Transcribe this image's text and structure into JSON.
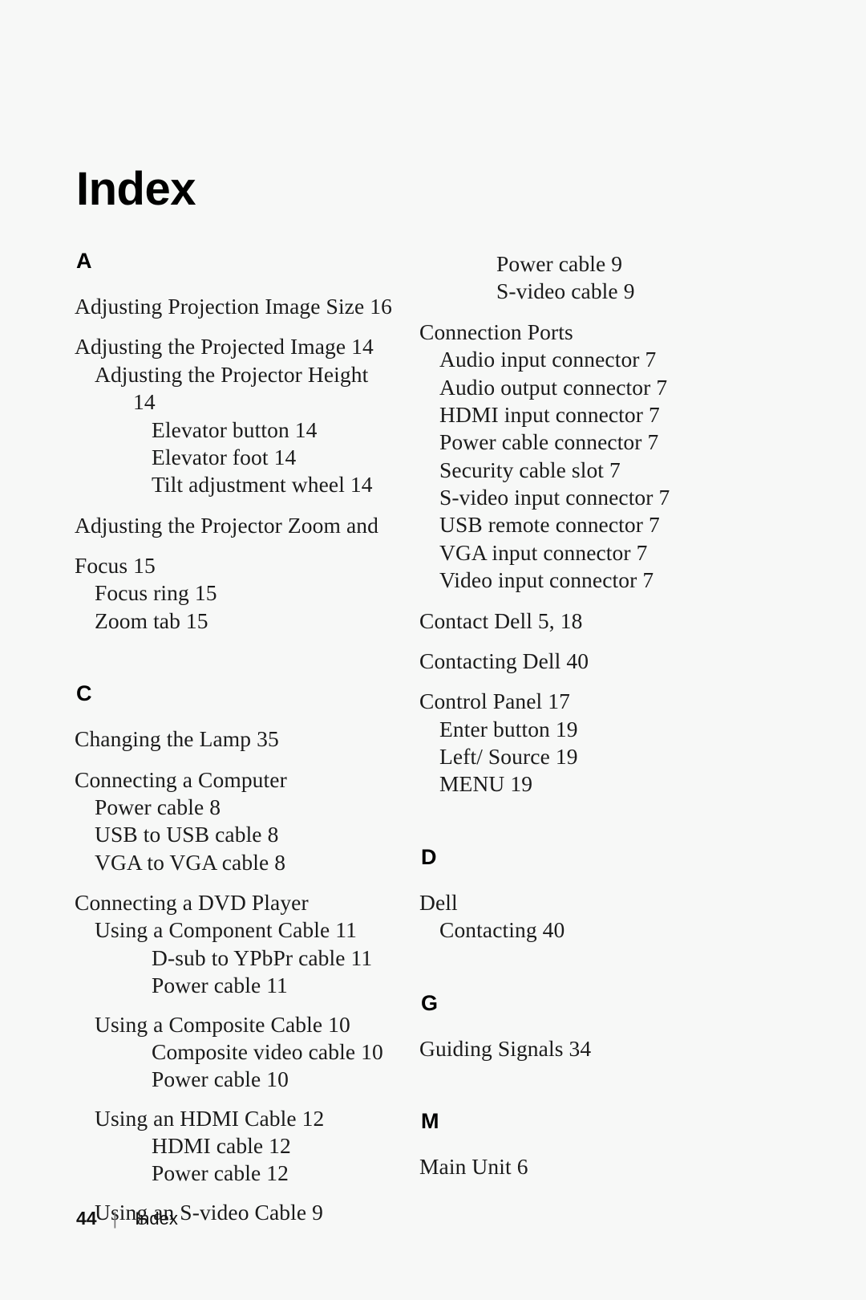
{
  "document": {
    "title": "Index"
  },
  "footer": {
    "page_number": "44",
    "separator": "|",
    "label": "Index"
  },
  "columns": {
    "left": {
      "sections": [
        {
          "letter": "A",
          "entries": [
            {
              "text": "Adjusting Projection Image Size 16",
              "level": 0
            },
            {
              "text": "Adjusting the Projected Image 14",
              "level": 0
            },
            {
              "text": "Adjusting the Projector Height",
              "level": 1
            },
            {
              "text": "14",
              "level": "cont"
            },
            {
              "text": "Elevator button 14",
              "level": 2
            },
            {
              "text": "Elevator foot 14",
              "level": 2
            },
            {
              "text": "Tilt adjustment wheel 14",
              "level": 2
            },
            {
              "text": "Adjusting the Projector Zoom and",
              "level": 0
            },
            {
              "text": "Focus 15",
              "level": 0
            },
            {
              "text": "Focus ring 15",
              "level": 1
            },
            {
              "text": "Zoom tab 15",
              "level": 1
            }
          ]
        },
        {
          "letter": "C",
          "entries": [
            {
              "text": "Changing the Lamp 35",
              "level": 0
            },
            {
              "text": "Connecting a Computer",
              "level": 0
            },
            {
              "text": "Power cable 8",
              "level": 1
            },
            {
              "text": "USB to USB cable 8",
              "level": 1
            },
            {
              "text": "VGA to VGA cable 8",
              "level": 1
            },
            {
              "text": "Connecting a DVD Player",
              "level": 0
            },
            {
              "text": "Using a Component Cable 11",
              "level": 1
            },
            {
              "text": "D-sub to YPbPr cable 11",
              "level": 2
            },
            {
              "text": "Power cable 11",
              "level": 2
            },
            {
              "text": "Using a Composite Cable 10",
              "level": 1
            },
            {
              "text": "Composite video cable 10",
              "level": 2
            },
            {
              "text": "Power cable 10",
              "level": 2
            },
            {
              "text": "Using an HDMI Cable 12",
              "level": 1
            },
            {
              "text": "HDMI cable 12",
              "level": 2
            },
            {
              "text": "Power cable 12",
              "level": 2
            },
            {
              "text": "Using an S-video Cable 9",
              "level": 1
            }
          ]
        }
      ]
    },
    "right": {
      "continued_entries": [
        {
          "text": "Power cable 9",
          "level": 2
        },
        {
          "text": "S-video cable 9",
          "level": 2
        }
      ],
      "sections": [
        {
          "letter": "",
          "entries": [
            {
              "text": "Connection Ports",
              "level": 0
            },
            {
              "text": "Audio input connector 7",
              "level": 1
            },
            {
              "text": "Audio output connector 7",
              "level": 1
            },
            {
              "text": "HDMI input connector 7",
              "level": 1
            },
            {
              "text": "Power cable connector 7",
              "level": 1
            },
            {
              "text": "Security cable slot 7",
              "level": 1
            },
            {
              "text": "S-video input connector 7",
              "level": 1
            },
            {
              "text": "USB remote connector 7",
              "level": 1
            },
            {
              "text": "VGA input connector 7",
              "level": 1
            },
            {
              "text": "Video input connector 7",
              "level": 1
            },
            {
              "text": "Contact Dell 5, 18",
              "level": 0
            },
            {
              "text": "Contacting Dell 40",
              "level": 0
            },
            {
              "text": "Control Panel 17",
              "level": 0
            },
            {
              "text": "Enter button 19",
              "level": 1
            },
            {
              "text": "Left/ Source 19",
              "level": 1
            },
            {
              "text": "MENU 19",
              "level": 1
            }
          ]
        },
        {
          "letter": "D",
          "entries": [
            {
              "text": "Dell",
              "level": 0
            },
            {
              "text": "Contacting 40",
              "level": 1
            }
          ]
        },
        {
          "letter": "G",
          "entries": [
            {
              "text": "Guiding Signals 34",
              "level": 0
            }
          ]
        },
        {
          "letter": "M",
          "entries": [
            {
              "text": "Main Unit 6",
              "level": 0
            }
          ]
        }
      ]
    }
  }
}
